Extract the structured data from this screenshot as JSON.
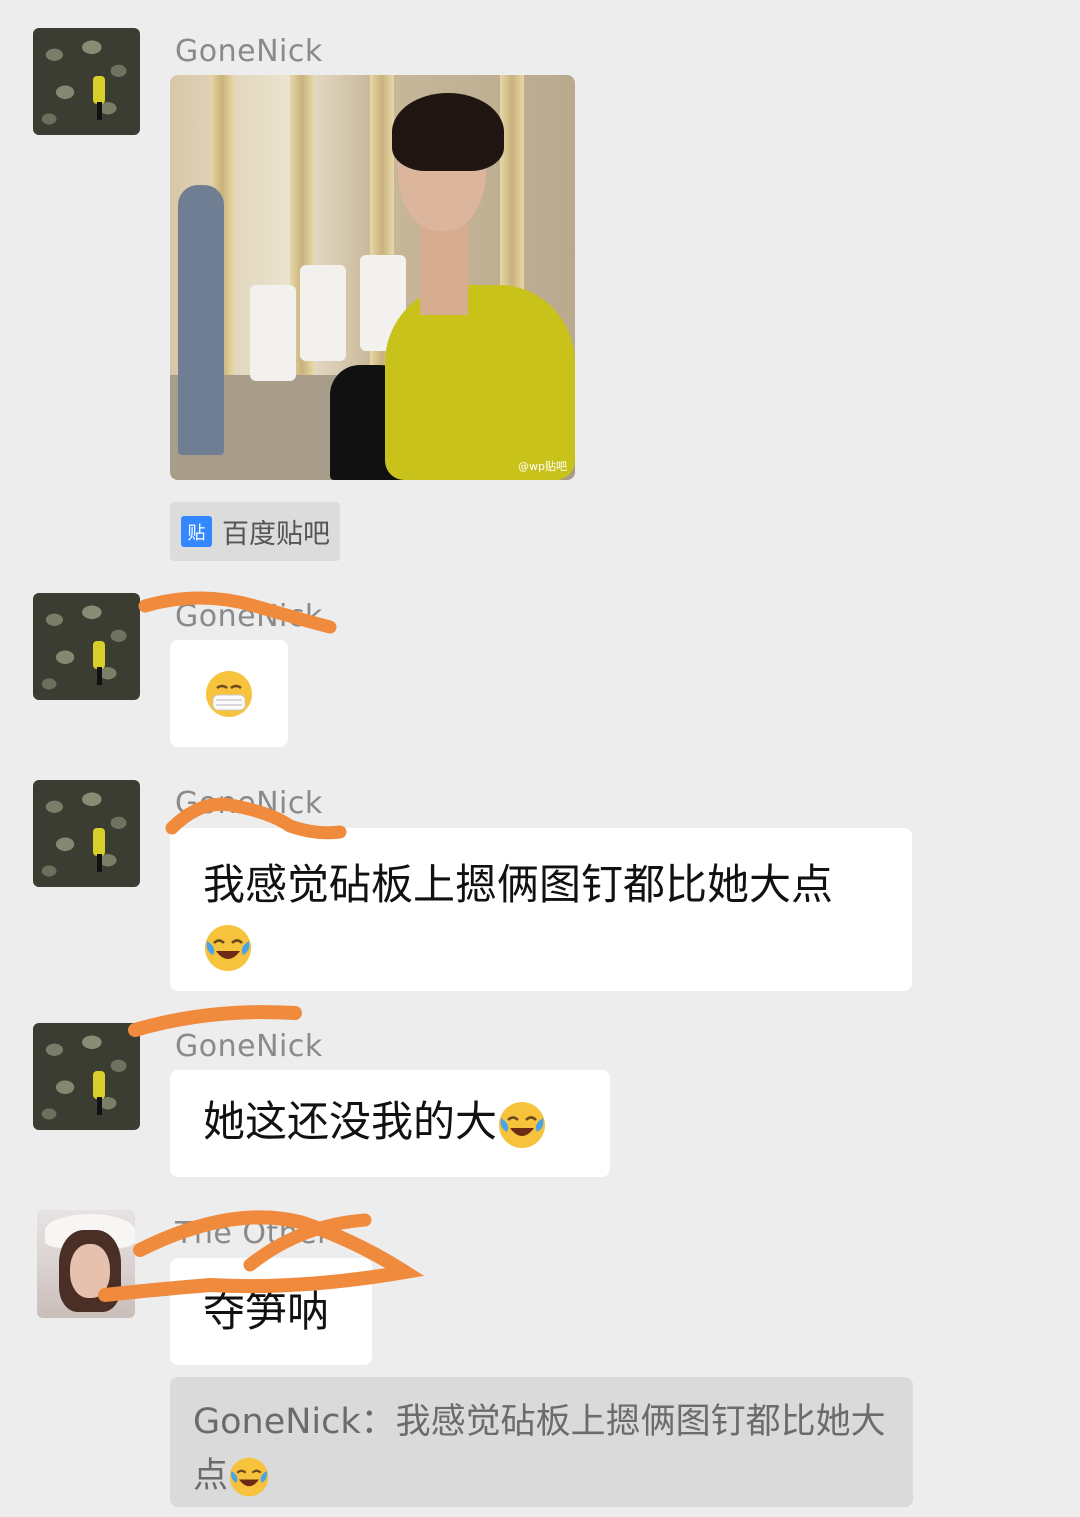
{
  "messages": [
    {
      "sender": "GoneNick",
      "type": "image",
      "source_label": "百度贴吧",
      "source_icon": "贴",
      "image_watermark": "@wp贴吧"
    },
    {
      "sender": "GoneNick",
      "type": "emoji",
      "emoji": "mask-face"
    },
    {
      "sender": "GoneNick",
      "type": "text",
      "text": "我感觉砧板上摁俩图钉都比她大点",
      "emoji": "laugh-cry"
    },
    {
      "sender": "GoneNick",
      "type": "text",
      "text": "她这还没我的大",
      "emoji": "laugh-cry"
    },
    {
      "sender": "The Other",
      "type": "text",
      "text": "夺笋呐",
      "quote": {
        "author": "GoneNick：",
        "text": "我感觉砧板上摁俩图钉都比她大点",
        "emoji": "laugh-cry"
      }
    }
  ],
  "colors": {
    "background": "#ededed",
    "bubble": "#ffffff",
    "scribble": "#f08a3c",
    "quote_bg": "#dadada"
  }
}
